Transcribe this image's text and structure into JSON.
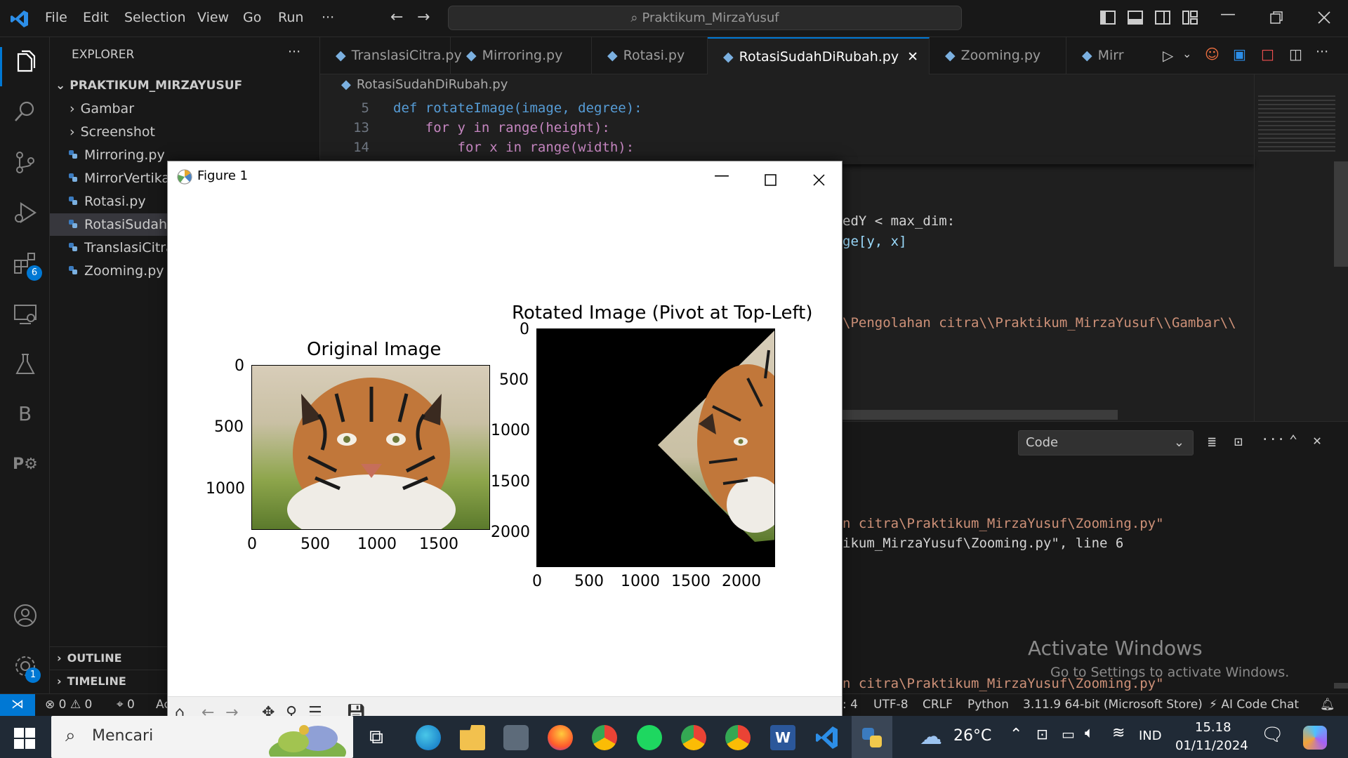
{
  "titlebar": {
    "menus": [
      "File",
      "Edit",
      "Selection",
      "View",
      "Go",
      "Run",
      "···"
    ],
    "search_text": "Praktikum_MirzaYusuf"
  },
  "activity": {
    "extensions_badge": "6",
    "settings_badge": "1"
  },
  "sidebar": {
    "header": "EXPLORER",
    "more": "···",
    "project": "PRAKTIKUM_MIRZAYUSUF",
    "items": [
      {
        "label": "Gambar",
        "type": "folder"
      },
      {
        "label": "Screenshot",
        "type": "folder"
      },
      {
        "label": "Mirroring.py",
        "type": "file"
      },
      {
        "label": "MirrorVertika",
        "type": "file"
      },
      {
        "label": "Rotasi.py",
        "type": "file"
      },
      {
        "label": "RotasiSudahDi",
        "type": "file"
      },
      {
        "label": "TranslasiCitra.",
        "type": "file"
      },
      {
        "label": "Zooming.py",
        "type": "file"
      }
    ],
    "outline": "OUTLINE",
    "timeline": "TIMELINE"
  },
  "tabs": [
    "TranslasiCitra.py",
    "Mirroring.py",
    "Rotasi.py",
    "RotasiSudahDiRubah.py",
    "Zooming.py",
    "Mirr"
  ],
  "editor": {
    "breadcrumb": "RotasiSudahDiRubah.py",
    "lines": [
      {
        "num": "5",
        "text": "def rotateImage(image, degree):"
      },
      {
        "num": "13",
        "text": "    for y in range(height):"
      },
      {
        "num": "14",
        "text": "        for x in range(width):"
      }
    ],
    "visible_fragments": [
      "edY < max_dim:",
      "ge[y, x]",
      "\\Pengolahan citra\\\\Praktikum_MirzaYusuf\\\\Gambar\\\\"
    ]
  },
  "panel": {
    "dropdown": "Code",
    "lines": [
      "n citra\\Praktikum_MirzaYusuf\\Zooming.py\"",
      "ikum_MirzaYusuf\\Zooming.py\", line 6",
      "n citra\\Praktikum_MirzaYusuf\\Zooming.py\""
    ],
    "watermark_title": "Activate Windows",
    "watermark_sub": "Go to Settings to activate Windows."
  },
  "statusbar": {
    "errors": "0",
    "warnings": "0",
    "ports": "0",
    "trunc": "Ac",
    "spaces": ": 4",
    "encoding": "UTF-8",
    "eol": "CRLF",
    "language": "Python",
    "interpreter": "3.11.9 64-bit (Microsoft Store)",
    "ai": "AI Code Chat"
  },
  "figure": {
    "title": "Figure 1",
    "left_axes": {
      "title": "Original Image",
      "xticks": [
        "0",
        "500",
        "1000",
        "1500"
      ],
      "yticks": [
        "0",
        "500",
        "1000"
      ]
    },
    "right_axes": {
      "title": "Rotated Image (Pivot at Top-Left)",
      "xticks": [
        "0",
        "500",
        "1000",
        "1500",
        "2000"
      ],
      "yticks": [
        "0",
        "500",
        "1000",
        "1500",
        "2000"
      ]
    }
  },
  "taskbar": {
    "search_placeholder": "Mencari",
    "weather": "26°C",
    "lang": "IND",
    "time": "15.18",
    "date": "01/11/2024"
  },
  "colors": {
    "accent": "#0078d4",
    "keyword": "#569cd6",
    "function": "#dcdcaa",
    "string": "#ce9178"
  }
}
